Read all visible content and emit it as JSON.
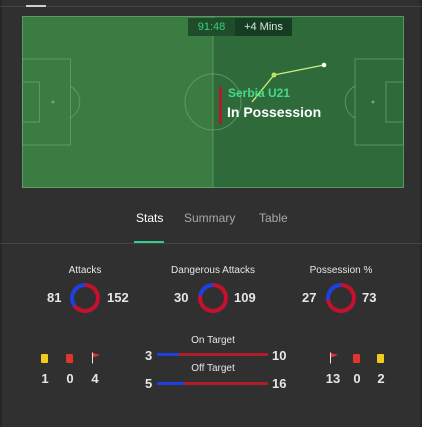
{
  "match": {
    "clock": "91:48",
    "added_time": "+4 Mins",
    "possession_team": "Serbia U21",
    "possession_status": "In Possession"
  },
  "tabs": [
    {
      "label": "Stats",
      "active": true
    },
    {
      "label": "Summary",
      "active": false
    },
    {
      "label": "Table",
      "active": false
    }
  ],
  "colors": {
    "home": "#1f3fe0",
    "away": "#c8102e",
    "accent": "#2fd08e",
    "pitch": "#3b7c42"
  },
  "stats": {
    "attacks": {
      "title": "Attacks",
      "home": "81",
      "away": "152"
    },
    "dangerous_attacks": {
      "title": "Dangerous Attacks",
      "home": "30",
      "away": "109"
    },
    "possession": {
      "title": "Possession %",
      "home": "27",
      "away": "73"
    }
  },
  "home_discipline": {
    "yellow_cards": "1",
    "red_cards": "0",
    "corners": "4"
  },
  "away_discipline": {
    "corners": "13",
    "red_cards": "0",
    "yellow_cards": "2"
  },
  "shots": {
    "on_target": {
      "label": "On Target",
      "home": "3",
      "away": "10"
    },
    "off_target": {
      "label": "Off Target",
      "home": "5",
      "away": "16"
    }
  },
  "icons": [
    "yellow-card-icon",
    "red-card-icon",
    "corner-flag-icon"
  ]
}
